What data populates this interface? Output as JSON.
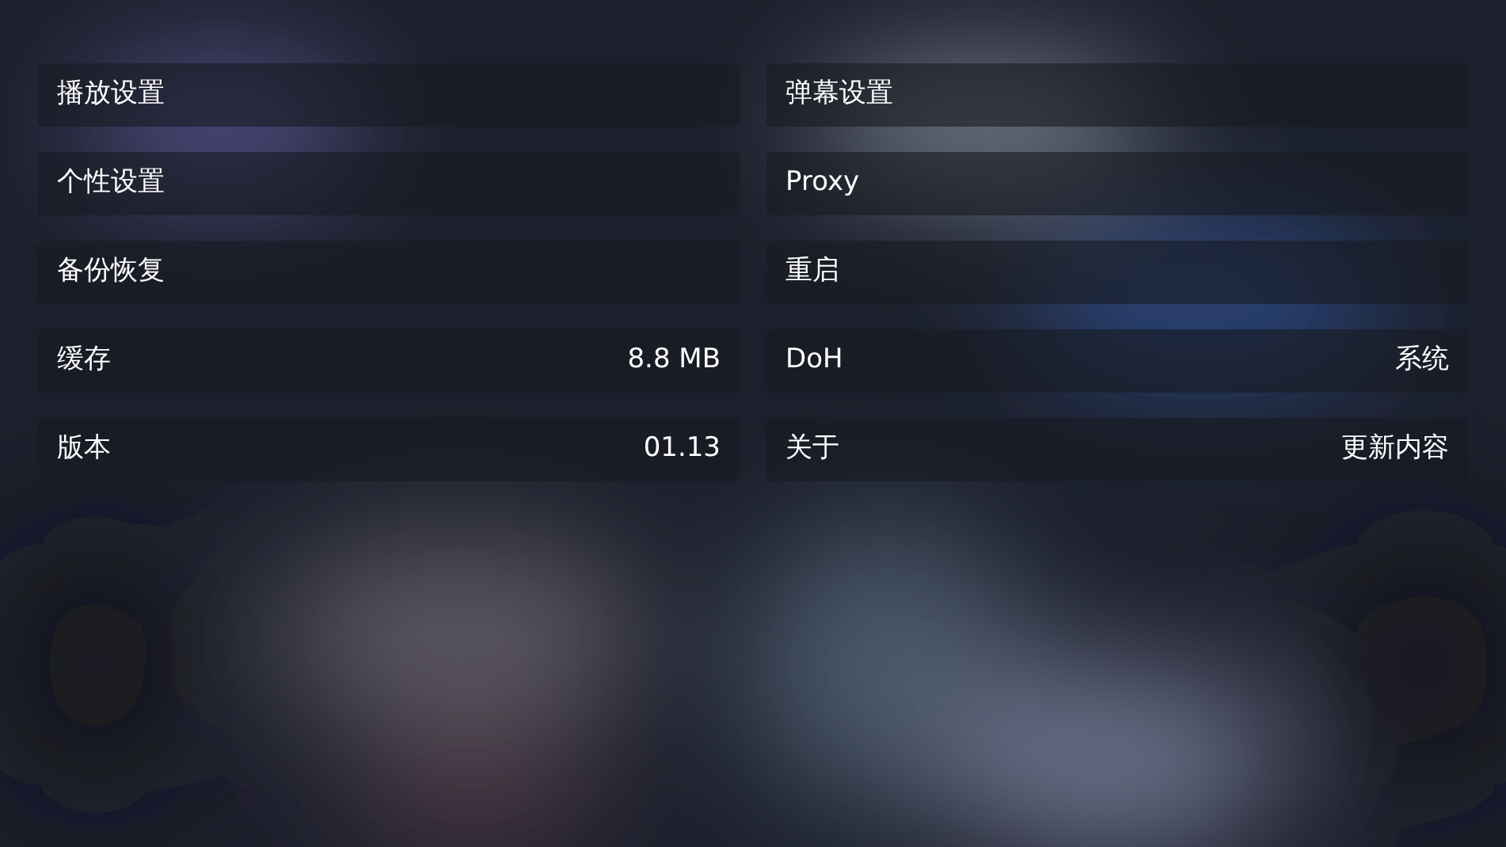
{
  "settings": [
    {
      "label": "播放设置"
    },
    {
      "label": "弹幕设置"
    },
    {
      "label": "个性设置"
    },
    {
      "label": "Proxy"
    },
    {
      "label": "备份恢复"
    },
    {
      "label": "重启"
    },
    {
      "label": "缓存",
      "value": "8.8 MB"
    },
    {
      "label": "DoH",
      "value": "系统"
    },
    {
      "label": "版本",
      "value": "01.13"
    },
    {
      "label": "关于",
      "value": "更新内容"
    }
  ]
}
